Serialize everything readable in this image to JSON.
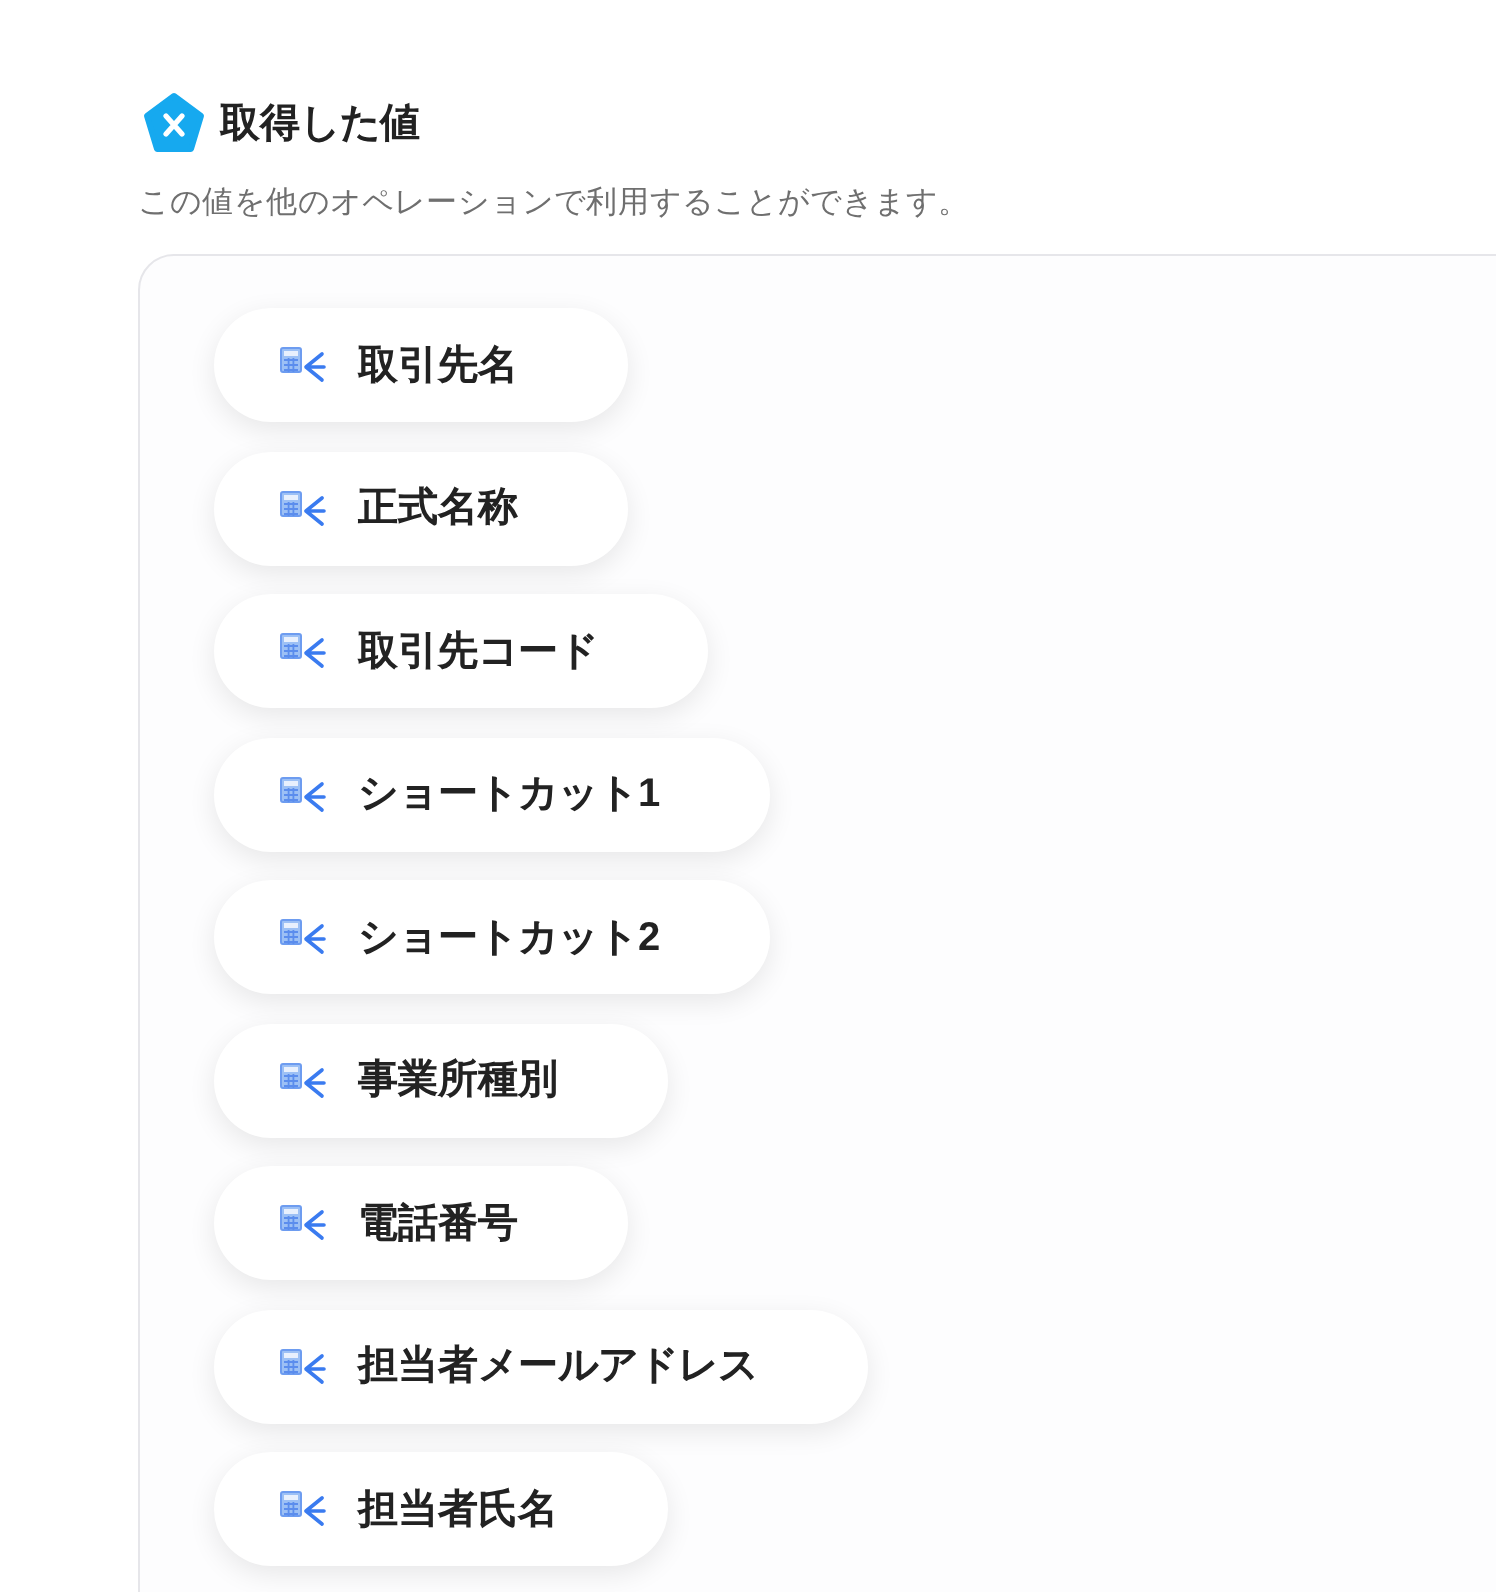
{
  "header": {
    "title": "取得した値",
    "description": "この値を他のオペレーションで利用することができます。"
  },
  "values": [
    "取引先名",
    "正式名称",
    "取引先コード",
    "ショートカット1",
    "ショートカット2",
    "事業所種別",
    "電話番号",
    "担当者メールアドレス",
    "担当者氏名"
  ]
}
